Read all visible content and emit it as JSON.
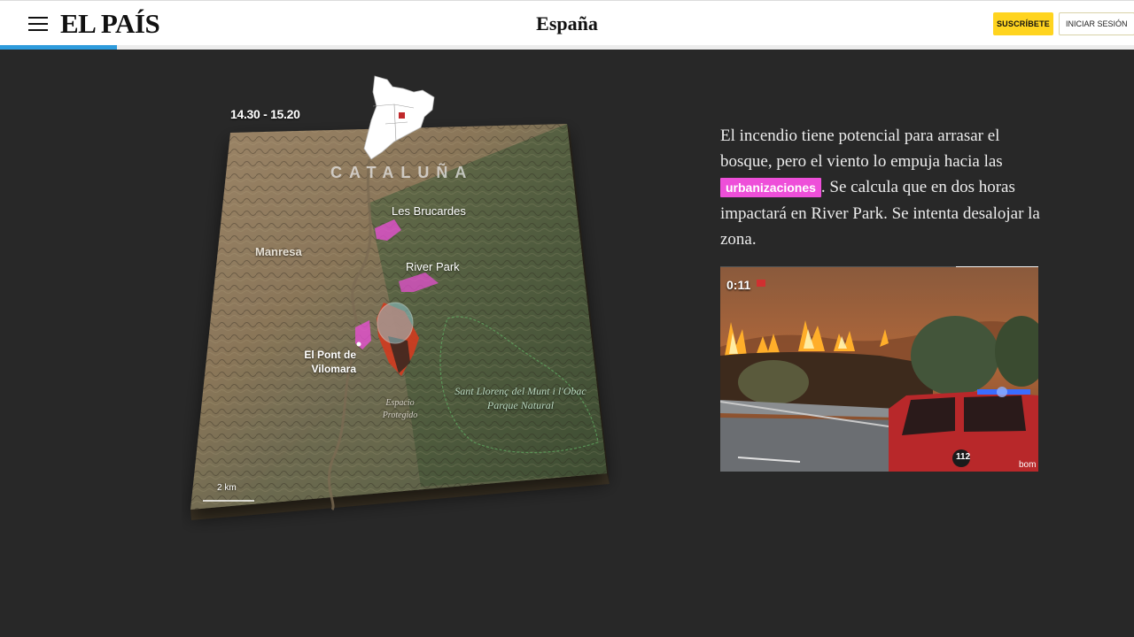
{
  "header": {
    "logo": "EL PAÍS",
    "section": "España",
    "subscribe_label": "SUSCRÍBETE",
    "login_label": "INICIAR SESIÓN",
    "progress_fraction": 0.103,
    "accent_color": "#2e9bdc",
    "subscribe_color": "#ffd41f"
  },
  "map": {
    "time_range": "14.30 - 15.20",
    "region": "CATALUÑA",
    "labels": {
      "les_brucardes": "Les Brucardes",
      "manresa": "Manresa",
      "river_park": "River Park",
      "el_pont": "El Pont de Vilomara",
      "park": "Sant Llorenç del Munt i l'Obac Parque Natural",
      "protected": "Espacio Protegido"
    },
    "scale": "2 km",
    "urban_color": "#ee4fd9",
    "fire_color": "#d23b1f"
  },
  "story": {
    "text_before": "El incendio tiene potencial para arrasar el bosque, pero el viento lo empuja hacia las ",
    "highlight": "urbanizaciones",
    "text_after": ". Se calcula que en dos horas impactará en River Park. Se intenta desalojar la zona.",
    "highlight_color": "#ee4fd9"
  },
  "video": {
    "time": "0:11",
    "progress_fraction": 0.74,
    "vehicle_number": "112",
    "vehicle_text": "bom"
  }
}
